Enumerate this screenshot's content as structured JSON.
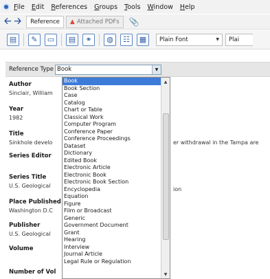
{
  "menubar": {
    "items": [
      "File",
      "Edit",
      "References",
      "Groups",
      "Tools",
      "Window",
      "Help"
    ],
    "underline": [
      "F",
      "E",
      "R",
      "G",
      "T",
      "W",
      "H"
    ]
  },
  "tabs": {
    "reference": "Reference",
    "attached_pdfs": "Attached PDFs"
  },
  "toolbar": {
    "font": "Plain Font",
    "font_size_partial": "Plai"
  },
  "reference_type": {
    "label": "Reference Type",
    "value": "Book"
  },
  "fields": {
    "author_label": "Author",
    "author_value": "Sinclair, William",
    "year_label": "Year",
    "year_value": "1982",
    "title_label": "Title",
    "title_value": "Sinkhole develo",
    "title_continuation": "er withdrawal in the Tampa are",
    "series_editor_label": "Series Editor",
    "series_title_label": "Series Title",
    "series_title_value": "U.S. Geological",
    "series_title_continuation": "ion",
    "place_published_label": "Place Published",
    "place_published_value": "Washington D.C",
    "publisher_label": "Publisher",
    "publisher_value": "U.S. Geological",
    "volume_label": "Volume",
    "number_of_volumes_label": "Number of Vol"
  },
  "dropdown": {
    "items": [
      "Book",
      "Book Section",
      "Case",
      "Catalog",
      "Chart or Table",
      "Classical Work",
      "Computer Program",
      "Conference Paper",
      "Conference Proceedings",
      "Dataset",
      "Dictionary",
      "Edited Book",
      "Electronic Article",
      "Electronic Book",
      "Electronic Book Section",
      "Encyclopedia",
      "Equation",
      "Figure",
      "Film or Broadcast",
      "Generic",
      "Government Document",
      "Grant",
      "Hearing",
      "Interview",
      "Journal Article",
      "Legal Rule or Regulation"
    ],
    "selected_index": 0
  }
}
